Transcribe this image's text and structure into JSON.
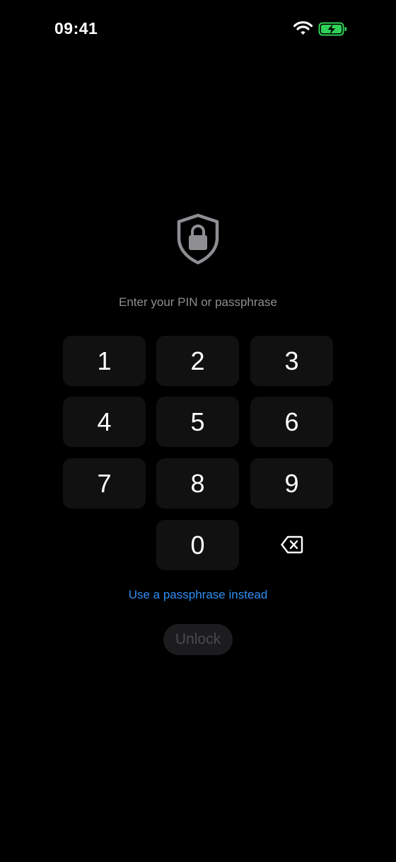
{
  "status_bar": {
    "time": "09:41",
    "wifi_icon": "wifi-icon",
    "battery_icon": "battery-charging-icon",
    "battery_color": "#30d158"
  },
  "lock": {
    "icon": "shield-lock-icon",
    "prompt": "Enter your PIN or passphrase"
  },
  "keypad": {
    "keys": [
      "1",
      "2",
      "3",
      "4",
      "5",
      "6",
      "7",
      "8",
      "9",
      "0"
    ],
    "delete_icon": "delete-backspace-icon"
  },
  "actions": {
    "alt_link": "Use a passphrase instead",
    "alt_link_color": "#2f8ef4",
    "unlock_label": "Unlock"
  }
}
